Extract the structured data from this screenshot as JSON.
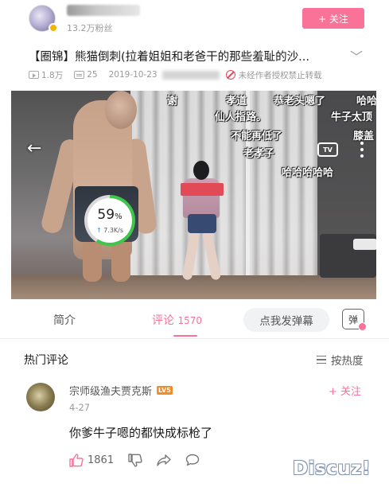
{
  "uploader": {
    "name": "",
    "fans": "13.2万粉丝",
    "follow_label": "+ 关注"
  },
  "video": {
    "title": "【圈锦】熊猫倒刺(拉着姐姐和老爸干的那些羞耻的沙...",
    "plays": "1.8万",
    "danmaku_count": "25",
    "date": "2019-10-23",
    "notice": "未经作者授权禁止转载",
    "danmaku": [
      "谢",
      "孝道",
      "恭老头嗯了",
      "哈哈",
      "仙人指路。",
      "牛子太顶",
      "不能再低了",
      "膝盖",
      "老孝子",
      "哈哈哈哈哈"
    ],
    "tv_label": "TV"
  },
  "network_widget": {
    "percent": 59,
    "percent_text": "59",
    "percent_unit": "%",
    "upload_arrow": "↑",
    "rate": "7.3K/s"
  },
  "tabs": {
    "intro": "简介",
    "comments": "评论",
    "comment_count": "1570",
    "danmaku_input": "点我发弹幕",
    "danmaku_toggle": "弹"
  },
  "comments": {
    "section_title": "热门评论",
    "sort_label": "按热度",
    "items": [
      {
        "author": "宗师级渔夫贾克斯",
        "level": "LV5",
        "follow": "+ 关注",
        "date": "4-27",
        "text": "你爹牛子嗯的都快成标枪了",
        "likes": "1861"
      }
    ]
  },
  "watermark": "Discuz!",
  "colors": {
    "accent": "#fb7299",
    "progress": "#3fc64b",
    "level_badge": "#f28c28",
    "ban_icon": "#e2465a"
  }
}
